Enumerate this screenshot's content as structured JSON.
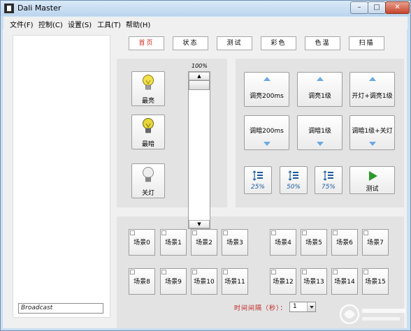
{
  "window": {
    "title": "Dali Master",
    "min": "–",
    "max": "□",
    "close": "✕"
  },
  "menu": [
    "文件(F)",
    "控制(C)",
    "设置(S)",
    "工具(T)",
    "帮助(H)"
  ],
  "tabs": [
    {
      "label": "首页",
      "active": true
    },
    {
      "label": "状态",
      "active": false
    },
    {
      "label": "测试",
      "active": false
    },
    {
      "label": "彩色",
      "active": false
    },
    {
      "label": "色温",
      "active": false
    },
    {
      "label": "扫描",
      "active": false
    }
  ],
  "broadcast": {
    "value": "Broadcast"
  },
  "brightness": {
    "max_label": "最亮",
    "min_label": "最暗",
    "off_label": "关灯"
  },
  "slider": {
    "value_label": "100%",
    "level": 1.0
  },
  "dim": {
    "up200": "调亮200ms",
    "up1": "调亮1级",
    "on_up1": "开灯+调亮1级",
    "down200": "调暗200ms",
    "down1": "调暗1级",
    "down1_off": "调暗1级+关灯"
  },
  "presets": [
    {
      "label": "25%"
    },
    {
      "label": "50%"
    },
    {
      "label": "75%"
    },
    {
      "label": "测试"
    }
  ],
  "scenes": [
    "场景0",
    "场景1",
    "场景2",
    "场景3",
    "场景4",
    "场景5",
    "场景6",
    "场景7",
    "场景8",
    "场景9",
    "场景10",
    "场景11",
    "场景12",
    "场景13",
    "场景14",
    "场景15"
  ],
  "interval": {
    "label": "时间间隔（秒）：",
    "value": "1"
  },
  "colors": {
    "accent_red": "#d4281c",
    "arrow_blue": "#6ba9e4",
    "play_green": "#2a9a2a",
    "bulb_yellow": "#f2e04a"
  }
}
